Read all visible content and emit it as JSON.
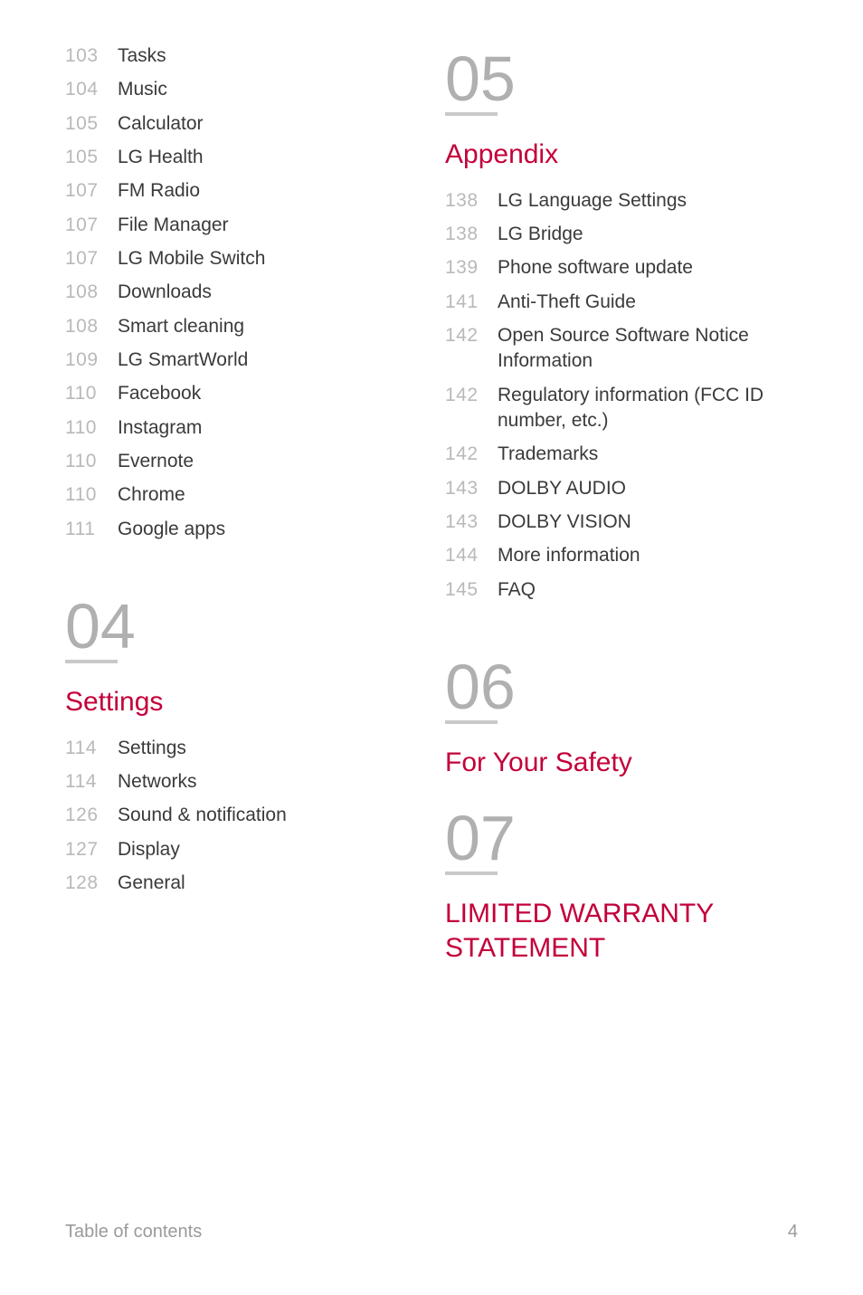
{
  "left": {
    "intro_items": [
      {
        "page": "103",
        "label": "Tasks"
      },
      {
        "page": "104",
        "label": "Music"
      },
      {
        "page": "105",
        "label": "Calculator"
      },
      {
        "page": "105",
        "label": "LG Health"
      },
      {
        "page": "107",
        "label": "FM Radio"
      },
      {
        "page": "107",
        "label": "File Manager"
      },
      {
        "page": "107",
        "label": "LG Mobile Switch"
      },
      {
        "page": "108",
        "label": "Downloads"
      },
      {
        "page": "108",
        "label": "Smart cleaning"
      },
      {
        "page": "109",
        "label": "LG SmartWorld"
      },
      {
        "page": "110",
        "label": "Facebook"
      },
      {
        "page": "110",
        "label": "Instagram"
      },
      {
        "page": "110",
        "label": "Evernote"
      },
      {
        "page": "110",
        "label": "Chrome"
      },
      {
        "page": "111",
        "label": "Google apps"
      }
    ],
    "section04": {
      "number": "04",
      "title": "Settings",
      "items": [
        {
          "page": "114",
          "label": "Settings"
        },
        {
          "page": "114",
          "label": "Networks"
        },
        {
          "page": "126",
          "label": "Sound & notification"
        },
        {
          "page": "127",
          "label": "Display"
        },
        {
          "page": "128",
          "label": "General"
        }
      ]
    }
  },
  "right": {
    "section05": {
      "number": "05",
      "title": "Appendix",
      "items": [
        {
          "page": "138",
          "label": "LG Language Settings"
        },
        {
          "page": "138",
          "label": "LG Bridge"
        },
        {
          "page": "139",
          "label": "Phone software update"
        },
        {
          "page": "141",
          "label": "Anti-Theft Guide"
        },
        {
          "page": "142",
          "label": "Open Source Software Notice Information"
        },
        {
          "page": "142",
          "label": "Regulatory information (FCC ID number, etc.)"
        },
        {
          "page": "142",
          "label": "Trademarks"
        },
        {
          "page": "143",
          "label": "DOLBY AUDIO"
        },
        {
          "page": "143",
          "label": "DOLBY VISION"
        },
        {
          "page": "144",
          "label": "More information"
        },
        {
          "page": "145",
          "label": "FAQ"
        }
      ]
    },
    "section06": {
      "number": "06",
      "title": "For Your Safety"
    },
    "section07": {
      "number": "07",
      "title": "LIMITED WARRANTY STATEMENT"
    }
  },
  "footer": {
    "left": "Table of contents",
    "right": "4"
  }
}
